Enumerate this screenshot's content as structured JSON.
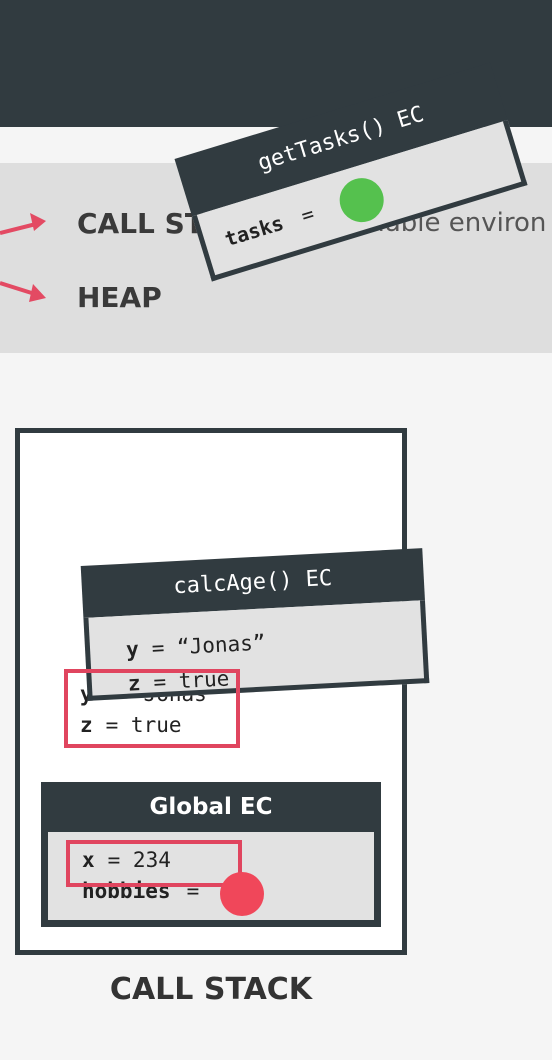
{
  "band": {
    "call_stack_label": "CALL ST",
    "variable_env_text": "ariable environ",
    "heap_label": "HEAP"
  },
  "get_tasks_ec": {
    "title": "getTasks() EC",
    "var_name": "tasks",
    "equals": "=",
    "dot_color": "#55c14e"
  },
  "calc_age_ec": {
    "title": "calcAge() EC",
    "line1_var": "y",
    "line1_rest": " = “Jonas”",
    "line2_var": "z",
    "line2_rest": " = true"
  },
  "copied_vars": {
    "line1_var": "y",
    "line1_rest": " = “Jonas”",
    "line2_var": "z",
    "line2_rest": " = true"
  },
  "global_ec": {
    "title": "Global EC",
    "x_var": "x",
    "x_rest": " = 234",
    "hobbies_var": "hobbies",
    "hobbies_rest": " =",
    "dot_color": "#f0475a"
  },
  "caption": "CALL STACK",
  "colors": {
    "dark": "#313b40",
    "highlight": "#e0455f",
    "arrow": "#e34a63"
  }
}
